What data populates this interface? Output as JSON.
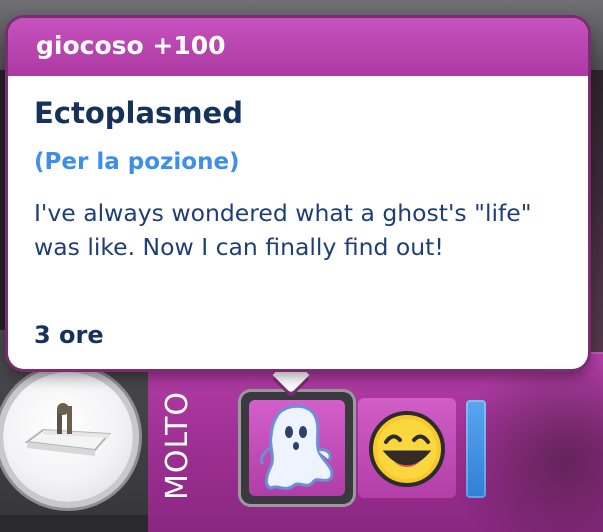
{
  "tooltip": {
    "header": "giocoso +100",
    "title": "Ectoplasmed",
    "subtitle": "(Per la pozione)",
    "description": "I've always wondered what a ghost's \"life\" was like. Now I can finally find out!",
    "duration": "3 ore"
  },
  "mood_panel": {
    "label": "MOLTO"
  },
  "moodlets": [
    {
      "icon": "ghost-icon",
      "selected": true
    },
    {
      "icon": "laughing-face-icon",
      "selected": false
    }
  ],
  "colors": {
    "accent_pink": "#b43fa8",
    "tooltip_title": "#17325a",
    "tooltip_subtitle": "#3f8fe6",
    "mood_meter": "#2f7fd6"
  }
}
